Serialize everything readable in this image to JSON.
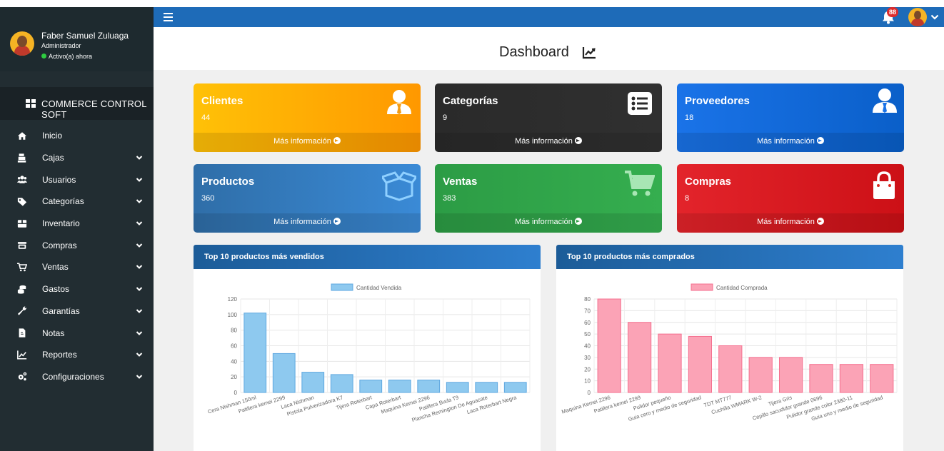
{
  "user": {
    "name": "Faber Samuel Zuluaga",
    "role": "Administrador",
    "status": "Activo(a) ahora"
  },
  "brand": "COMMERCE CONTROL SOFT",
  "menu": [
    {
      "label": "Inicio",
      "icon": "home-icon",
      "expandable": false
    },
    {
      "label": "Cajas",
      "icon": "cash-register-icon",
      "expandable": true
    },
    {
      "label": "Usuarios",
      "icon": "users-icon",
      "expandable": true
    },
    {
      "label": "Categorías",
      "icon": "tags-icon",
      "expandable": true
    },
    {
      "label": "Inventario",
      "icon": "box-icon",
      "expandable": true
    },
    {
      "label": "Compras",
      "icon": "store-icon",
      "expandable": true
    },
    {
      "label": "Ventas",
      "icon": "cart-icon",
      "expandable": true
    },
    {
      "label": "Gastos",
      "icon": "coins-icon",
      "expandable": true
    },
    {
      "label": "Garantías",
      "icon": "wrench-icon",
      "expandable": true
    },
    {
      "label": "Notas",
      "icon": "file-icon",
      "expandable": true
    },
    {
      "label": "Reportes",
      "icon": "chart-line-icon",
      "expandable": true
    },
    {
      "label": "Configuraciones",
      "icon": "cogs-icon",
      "expandable": true
    }
  ],
  "topbar": {
    "notifications_count": "88"
  },
  "header": {
    "title": "Dashboard"
  },
  "cards": [
    {
      "title": "Clientes",
      "value": "44",
      "link": "Más información",
      "icon": "user-tie-icon",
      "color": "#f39c12"
    },
    {
      "title": "Categorías",
      "value": "9",
      "link": "Más información",
      "icon": "list-icon",
      "color": "#2b2b2b"
    },
    {
      "title": "Proveedores",
      "value": "18",
      "link": "Más información",
      "icon": "user-tie-icon",
      "color": "#1a73e8"
    },
    {
      "title": "Productos",
      "value": "360",
      "link": "Más información",
      "icon": "box-open-icon",
      "color": "#2a6fb5"
    },
    {
      "title": "Ventas",
      "value": "383",
      "link": "Más información",
      "icon": "shopping-cart-icon",
      "color": "#2e9e44"
    },
    {
      "title": "Compras",
      "value": "8",
      "link": "Más información",
      "icon": "shopping-bag-icon",
      "color": "#d9281f"
    }
  ],
  "panels": {
    "sold_title": "Top 10 productos más vendidos",
    "bought_title": "Top 10 productos más comprados"
  },
  "chart_data": [
    {
      "type": "bar",
      "categories": [
        "Cera Nishman 150ml",
        "Patillera kemei 2299",
        "Laca Nishman",
        "Pistola Pulverizadora K7",
        "Tijera Roterbart",
        "Capa Roterbart",
        "Maquina Kemei 2296",
        "Patillera Buda T9",
        "Plancha Remington De Aguacate",
        "Laca Roterbart Negra"
      ],
      "series": [
        {
          "name": "Cantidad Vendida",
          "values": [
            102,
            50,
            26,
            23,
            16,
            16,
            16,
            13,
            13,
            13
          ]
        }
      ],
      "ylim": [
        0,
        120
      ],
      "yticks": [
        0,
        20,
        40,
        60,
        80,
        100,
        120
      ],
      "grid": true,
      "legend": "top",
      "bar_color": "#8ec9ef",
      "border_color": "#5fa8e0"
    },
    {
      "type": "bar",
      "categories": [
        "Maquina Kemei 2296",
        "Patillera kemei 2299",
        "Pulidor pequeño",
        "Guia cero y medio de seguridad",
        "TDT MT777",
        "Cuchilla WMARK W-2",
        "Tijera Gris",
        "Cepillo sacudidor grande 0696",
        "Pulidor grande color 2380-11",
        "Guia uno y medio de seguridad"
      ],
      "series": [
        {
          "name": "Cantidad Comprada",
          "values": [
            80,
            60,
            50,
            48,
            40,
            30,
            30,
            24,
            24,
            24
          ]
        }
      ],
      "ylim": [
        0,
        80
      ],
      "yticks": [
        0,
        10,
        20,
        30,
        40,
        50,
        60,
        70,
        80
      ],
      "grid": true,
      "legend": "top",
      "bar_color": "#fba3b6",
      "border_color": "#f56f8f"
    }
  ]
}
